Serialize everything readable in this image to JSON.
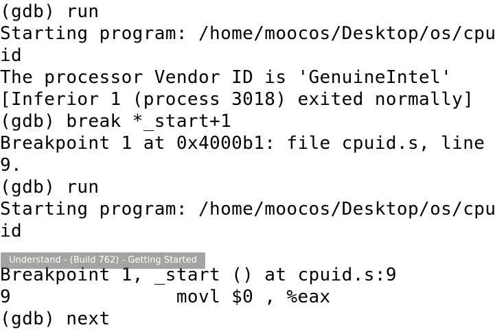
{
  "terminal": {
    "lines": [
      "(gdb) run",
      "Starting program: /home/moocos/Desktop/os/cpu",
      "id",
      "The processor Vendor ID is 'GenuineIntel'",
      "[Inferior 1 (process 3018) exited normally]",
      "(gdb) break *_start+1",
      "Breakpoint 1 at 0x4000b1: file cpuid.s, line",
      "9.",
      "(gdb) run",
      "Starting program: /home/moocos/Desktop/os/cpu",
      "id",
      "",
      "Breakpoint 1, _start () at cpuid.s:9",
      "9               movl $0 , %eax",
      "(gdb) next"
    ]
  },
  "tooltip": {
    "text": "Understand - (Build 762) - Getting Started"
  },
  "colors": {
    "background": "#ffffff",
    "text": "#000000",
    "tooltip_background": "#4e4e4a"
  }
}
